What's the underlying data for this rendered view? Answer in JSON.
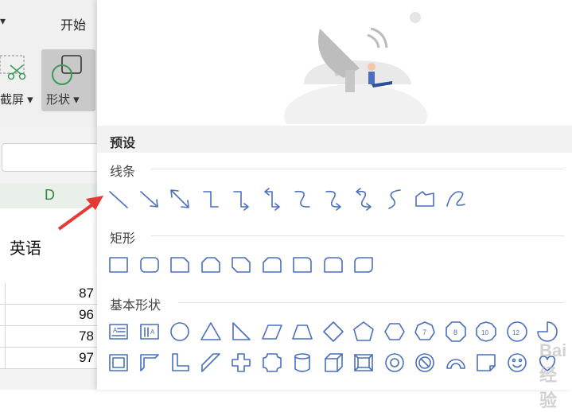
{
  "ribbon": {
    "tab_start": "开始",
    "screenshot_label": "截屏",
    "shape_label": "形状"
  },
  "sheet": {
    "column_letter": "D",
    "header_cell": "英语",
    "values": [
      "87",
      "96",
      "78",
      "97"
    ]
  },
  "panel": {
    "preset_title": "预设",
    "sections": {
      "lines": "线条",
      "rectangles": "矩形",
      "basic": "基本形状"
    }
  },
  "watermark": "Bai 经验",
  "colors": {
    "icon_stroke": "#4a6fc0",
    "arrow": "#e53935",
    "sheet_green": "#2e8b3d"
  },
  "icons": {
    "lines": [
      "line",
      "arrow-line",
      "double-arrow-line",
      "elbow-connector",
      "elbow-arrow-connector",
      "elbow-double-arrow-connector",
      "curved-connector",
      "curved-arrow-connector",
      "curved-double-arrow-connector",
      "curve",
      "freeform",
      "scribble"
    ],
    "rectangles": [
      "rectangle",
      "rounded-rectangle",
      "snip-single-corner-rectangle",
      "snip-same-side-corner-rectangle",
      "snip-diagonal-corner-rectangle",
      "snip-and-round-rectangle",
      "round-single-corner-rectangle",
      "round-same-side-corner-rectangle",
      "round-diagonal-corner-rectangle"
    ],
    "basic_row1": [
      "text-box",
      "vertical-text-box",
      "oval",
      "triangle",
      "right-triangle",
      "parallelogram",
      "trapezoid",
      "diamond",
      "pentagon",
      "hexagon",
      "heptagon",
      "octagon",
      "decagon",
      "dodecagon",
      "pie",
      "partial"
    ],
    "basic_row2": [
      "frame",
      "half-frame",
      "l-shape",
      "diagonal-stripe",
      "cross",
      "plaque",
      "can",
      "cube",
      "bevel",
      "donut",
      "no-symbol",
      "block-arc",
      "folded-corner",
      "smiley-face",
      "heart",
      "partial"
    ]
  }
}
